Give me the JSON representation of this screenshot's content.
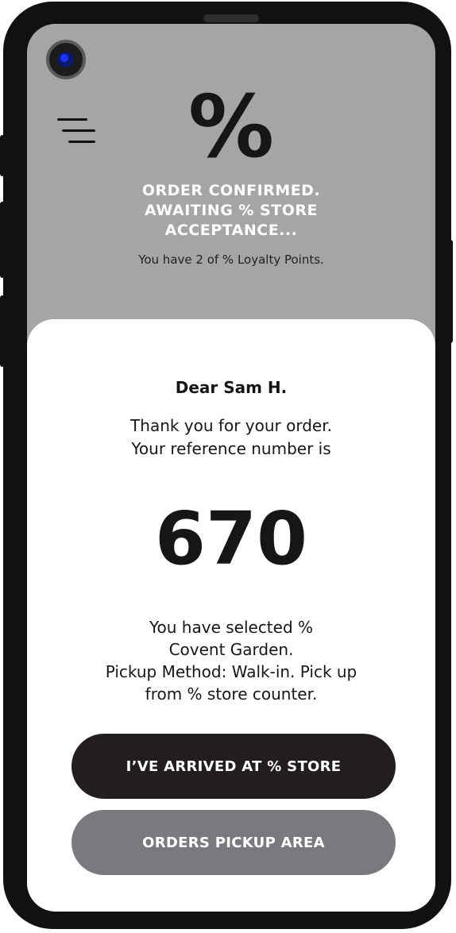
{
  "header": {
    "logo_symbol": "%",
    "status_lines": [
      "ORDER CONFIRMED.",
      "AWAITING % STORE",
      "ACCEPTANCE..."
    ],
    "loyalty_text": "You have 2 of % Loyalty Points."
  },
  "confirmation": {
    "greeting": "Dear Sam H.",
    "thanks_lines": [
      "Thank you for your order.",
      "Your reference number is"
    ],
    "reference_number": "670",
    "selection_lines": [
      "You have selected %",
      "Covent Garden.",
      "Pickup Method: Walk-in. Pick up",
      "from % store counter."
    ]
  },
  "actions": {
    "arrived_label": "I’VE ARRIVED AT % STORE",
    "pickup_area_label": "ORDERS PICKUP AREA"
  },
  "icons": {
    "menu": "menu-icon",
    "camera": "camera-icon"
  },
  "colors": {
    "header_bg": "#a5a5a5",
    "primary_button": "#221e1f",
    "secondary_button": "#7a7a7e",
    "text_dark": "#161616"
  }
}
